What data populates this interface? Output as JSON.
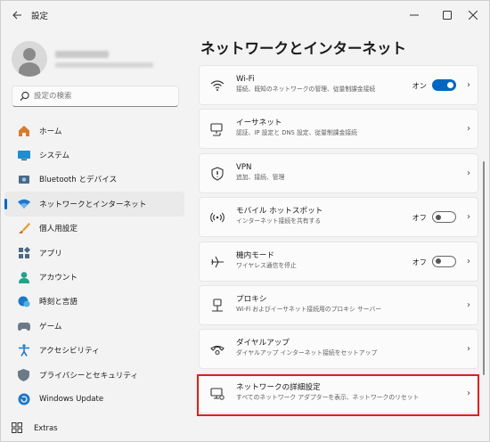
{
  "window": {
    "title": "設定",
    "back_icon": "back-arrow-icon",
    "controls": [
      "minimize-icon",
      "maximize-icon",
      "close-icon"
    ]
  },
  "sidebar": {
    "search": {
      "placeholder": "設定の検索",
      "icon": "search-icon"
    },
    "items": [
      {
        "label": "ホーム",
        "icon": "home-icon"
      },
      {
        "label": "システム",
        "icon": "system-icon"
      },
      {
        "label": "Bluetooth とデバイス",
        "icon": "bluetooth-icon"
      },
      {
        "label": "ネットワークとインターネット",
        "icon": "network-icon",
        "selected": true
      },
      {
        "label": "個人用設定",
        "icon": "brush-icon"
      },
      {
        "label": "アプリ",
        "icon": "apps-icon"
      },
      {
        "label": "アカウント",
        "icon": "account-icon"
      },
      {
        "label": "時刻と言語",
        "icon": "time-language-icon"
      },
      {
        "label": "ゲーム",
        "icon": "gaming-icon"
      },
      {
        "label": "アクセシビリティ",
        "icon": "accessibility-icon"
      },
      {
        "label": "プライバシーとセキュリティ",
        "icon": "shield-icon"
      },
      {
        "label": "Windows Update",
        "icon": "windows-update-icon"
      }
    ],
    "extras": {
      "label": "Extras",
      "icon": "extras-icon"
    }
  },
  "main": {
    "title": "ネットワークとインターネット",
    "cards": [
      {
        "title": "Wi-Fi",
        "desc": "接続、既知のネットワークの管理、従量制課金接続",
        "icon": "wifi-icon",
        "toggle_label": "オン",
        "toggle": true
      },
      {
        "title": "イーサネット",
        "desc": "認証、IP 設定と DNS 設定、従量制課金接続",
        "icon": "ethernet-icon"
      },
      {
        "title": "VPN",
        "desc": "追加、接続、管理",
        "icon": "vpn-shield-icon"
      },
      {
        "title": "モバイル ホットスポット",
        "desc": "インターネット接続を共有する",
        "icon": "hotspot-icon",
        "toggle_label": "オフ",
        "toggle": false
      },
      {
        "title": "機内モード",
        "desc": "ワイヤレス通信を停止",
        "icon": "airplane-icon",
        "toggle_label": "オフ",
        "toggle": false
      },
      {
        "title": "プロキシ",
        "desc": "Wi-Fi およびイーサネット接続用のプロキシ サーバー",
        "icon": "proxy-icon"
      },
      {
        "title": "ダイヤルアップ",
        "desc": "ダイヤルアップ インターネット接続をセットアップ",
        "icon": "dialup-icon"
      },
      {
        "title": "ネットワークの詳細設定",
        "desc": "すべてのネットワーク アダプターを表示、ネットワークのリセット",
        "icon": "advanced-network-icon"
      }
    ]
  },
  "colors": {
    "accent": "#0067c0",
    "highlight_box": "#e0201b",
    "window_bg": "#f3f3f3",
    "card_bg": "#fbfbfb"
  }
}
